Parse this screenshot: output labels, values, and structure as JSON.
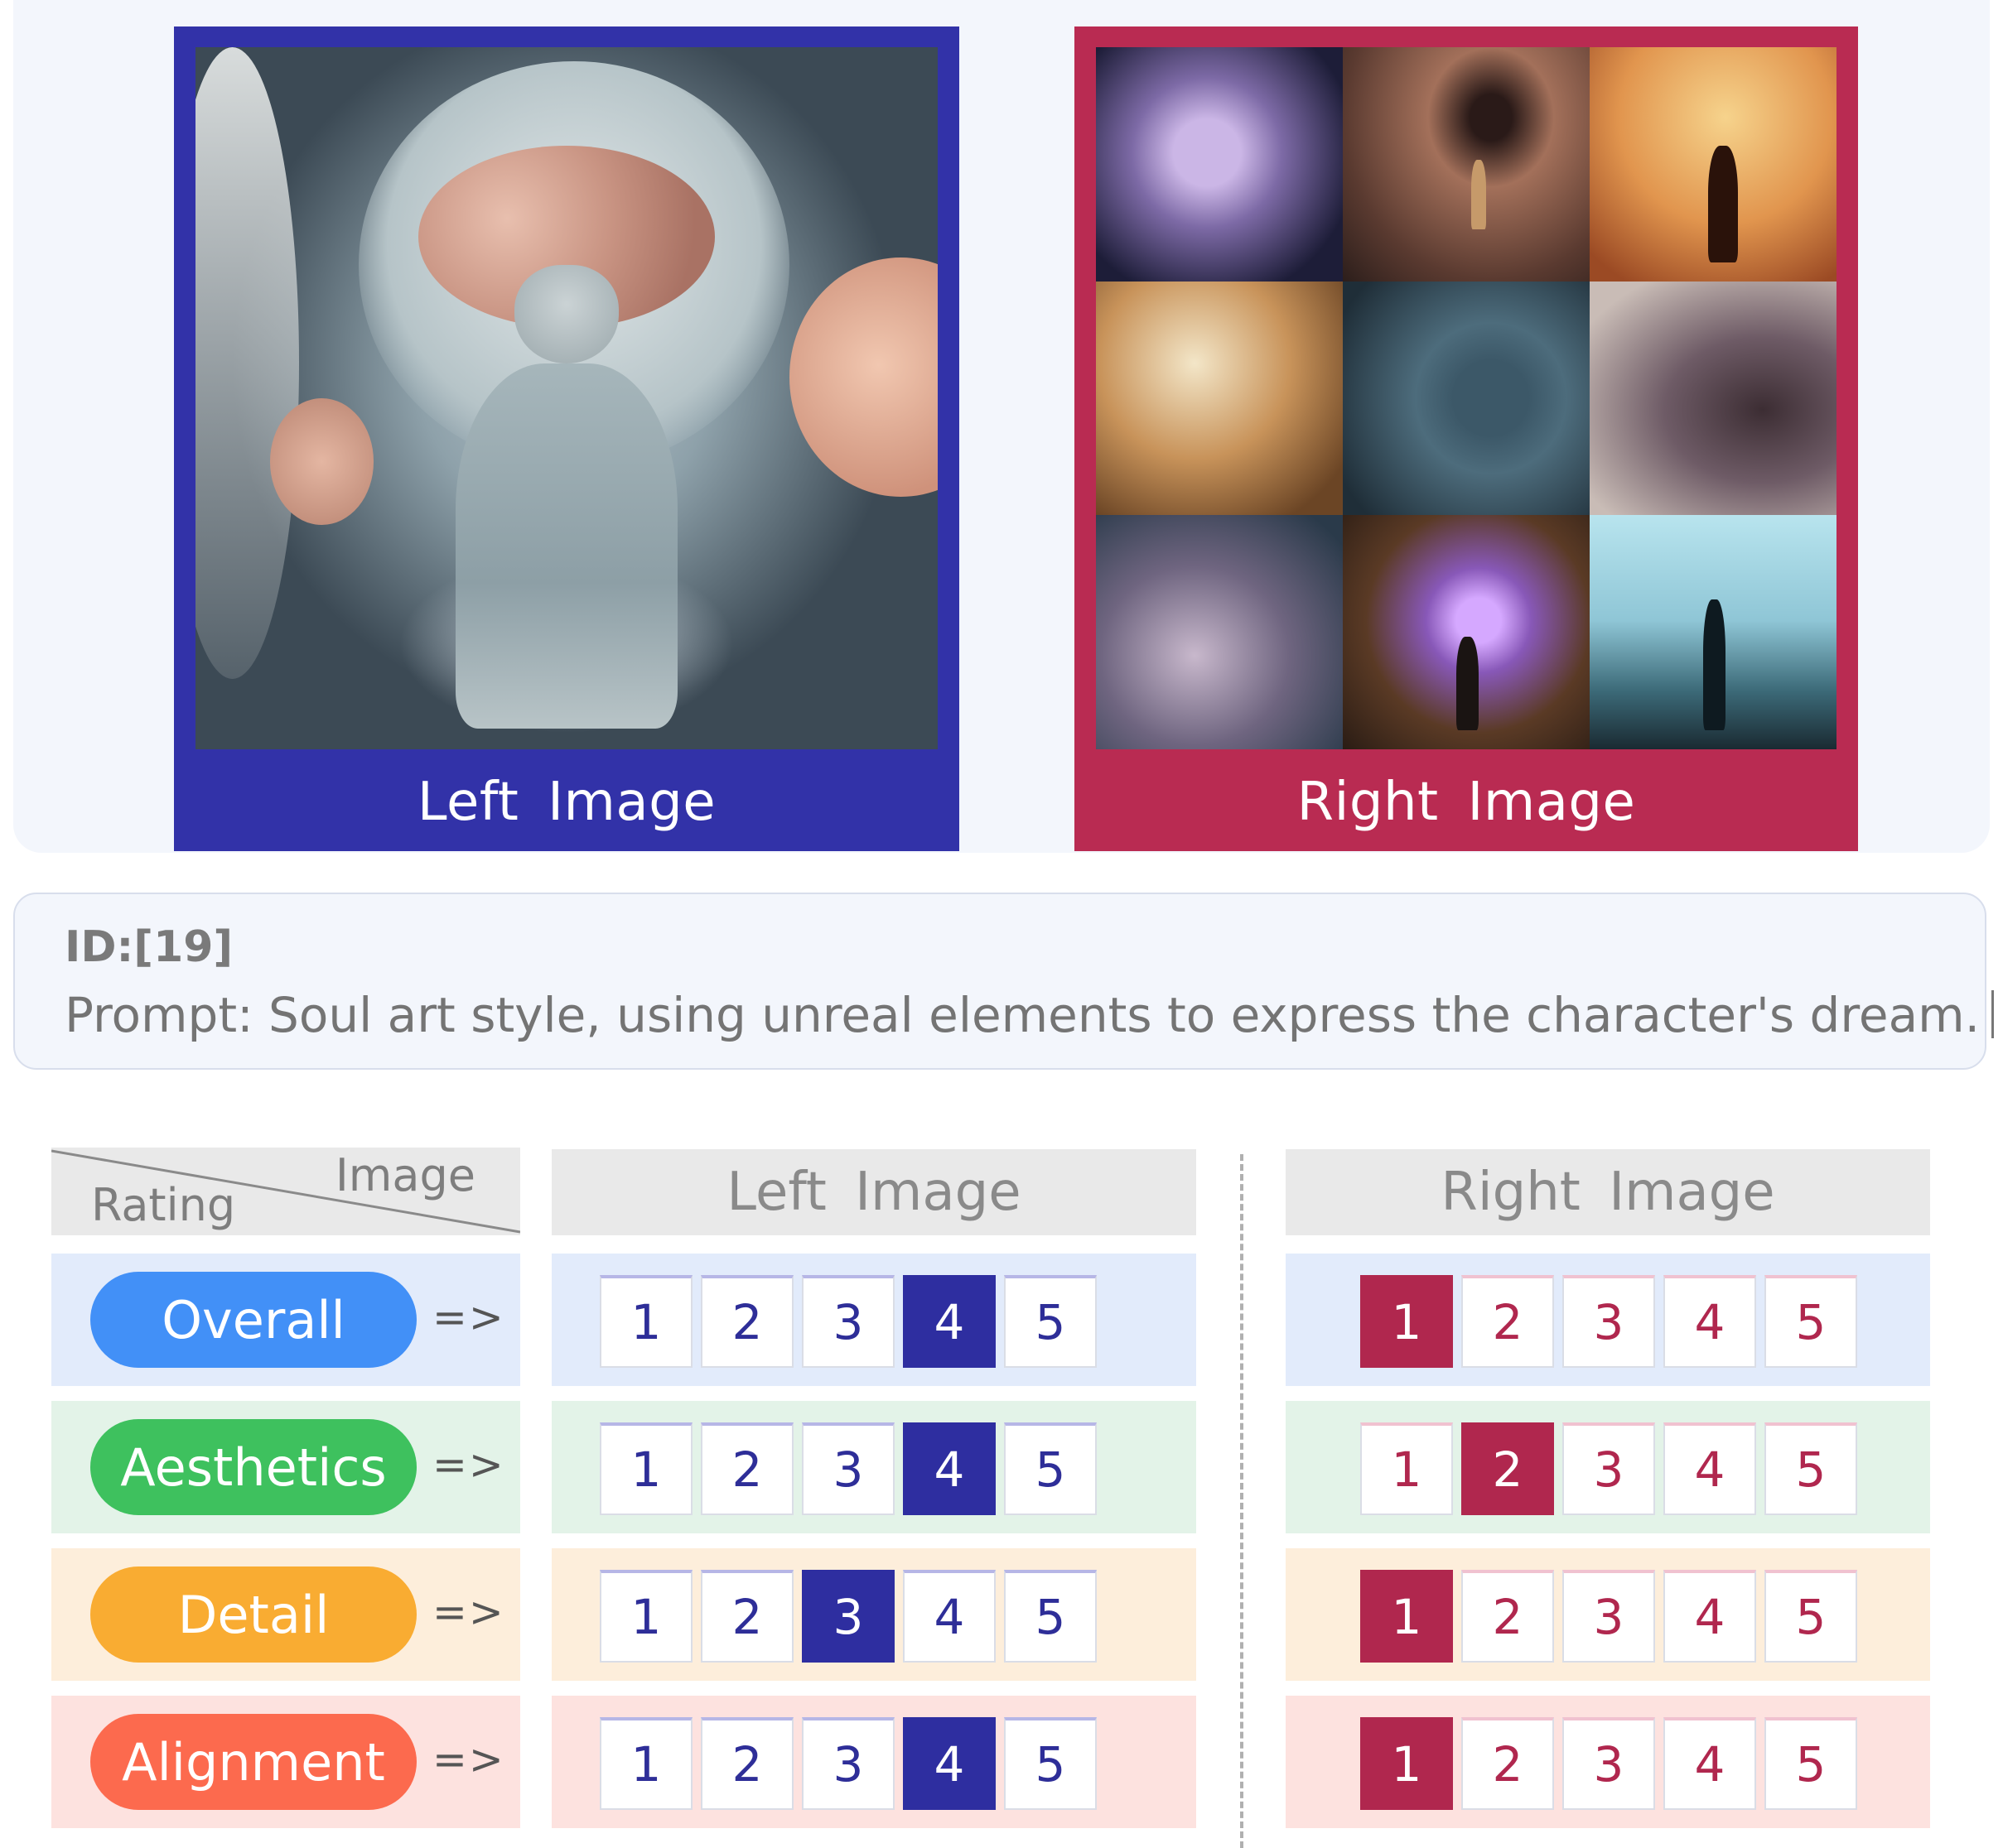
{
  "left_image": {
    "caption": "Left  Image"
  },
  "right_image": {
    "caption": "Right  Image"
  },
  "prompt": {
    "id": "ID:[19]",
    "text": "Prompt: Soul art style, using unreal elements to express the character's dream."
  },
  "table": {
    "corner_row_label": "Rating",
    "corner_col_label": "Image",
    "left_header": "Left  Image",
    "right_header": "Right  Image",
    "arrow": "=>",
    "options": [
      "1",
      "2",
      "3",
      "4",
      "5"
    ],
    "rows": [
      {
        "label": "Overall",
        "pill_color": "#4290f7",
        "bg": "#e2ebfb",
        "left_selected": 4,
        "right_selected": 1
      },
      {
        "label": "Aesthetics",
        "pill_color": "#3ec15e",
        "bg": "#e3f3e8",
        "left_selected": 4,
        "right_selected": 2
      },
      {
        "label": "Detail",
        "pill_color": "#f9ac32",
        "bg": "#fdeedb",
        "left_selected": 3,
        "right_selected": 1
      },
      {
        "label": "Alignment",
        "pill_color": "#fc6a4e",
        "bg": "#fde2df",
        "left_selected": 4,
        "right_selected": 1
      }
    ]
  },
  "colors": {
    "left_accent": "#3232a8",
    "right_accent": "#b92b52"
  }
}
